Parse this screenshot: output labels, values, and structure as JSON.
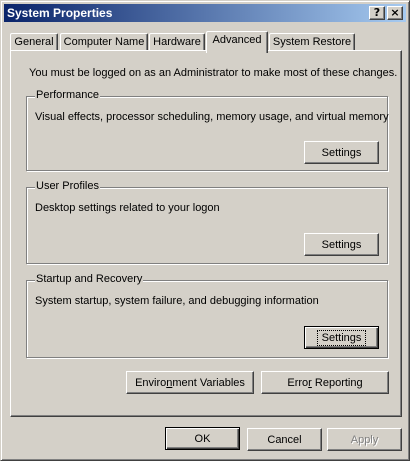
{
  "window": {
    "title": "System Properties",
    "help_label": "?",
    "close_label": "×"
  },
  "tabs": [
    {
      "label": "General"
    },
    {
      "label": "Computer Name"
    },
    {
      "label": "Hardware"
    },
    {
      "label": "Advanced",
      "selected": true
    },
    {
      "label": "System Restore"
    }
  ],
  "advanced": {
    "notice": "You must be logged on as an Administrator to make most of these changes.",
    "performance": {
      "label": "Performance",
      "description": "Visual effects, processor scheduling, memory usage, and virtual memory",
      "button": "Settings"
    },
    "user_profiles": {
      "label": "User Profiles",
      "description": "Desktop settings related to your logon",
      "button": "Settings"
    },
    "startup_recovery": {
      "label": "Startup and Recovery",
      "description": "System startup, system failure, and debugging information",
      "button": "Settings"
    },
    "env_vars_button": {
      "pre": "Enviro",
      "accel": "n",
      "post": "ment Variables"
    },
    "error_reporting_button": {
      "pre": "Erro",
      "accel": "r",
      "post": " Reporting"
    }
  },
  "footer": {
    "ok": "OK",
    "cancel": "Cancel",
    "apply": "Apply"
  }
}
